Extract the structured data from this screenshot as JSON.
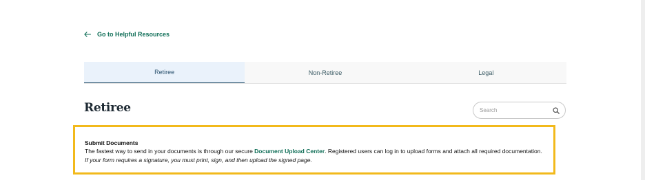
{
  "back_link": {
    "label": "Go to Helpful Resources",
    "icon": "arrow-left-icon"
  },
  "tabs": [
    {
      "label": "Retiree",
      "active": true
    },
    {
      "label": "Non-Retiree",
      "active": false
    },
    {
      "label": "Legal",
      "active": false
    }
  ],
  "page_title": "Retiree",
  "search": {
    "placeholder": "Search",
    "value": "",
    "icon": "search-icon"
  },
  "notice": {
    "title": "Submit Documents",
    "body_before": "The fastest way to send in your documents is through our secure ",
    "link_text": "Document Upload Center",
    "body_after": ". Registered users can log in to upload forms and attach all required documentation. ",
    "italic_note": "If your form requires a signature, you must print, sign, and then upload the signed page."
  },
  "colors": {
    "accent_green": "#0f6e57",
    "active_tab_bg": "#eaf2fb",
    "active_tab_underline": "#1e4a66",
    "notice_border": "#f2b91b"
  }
}
